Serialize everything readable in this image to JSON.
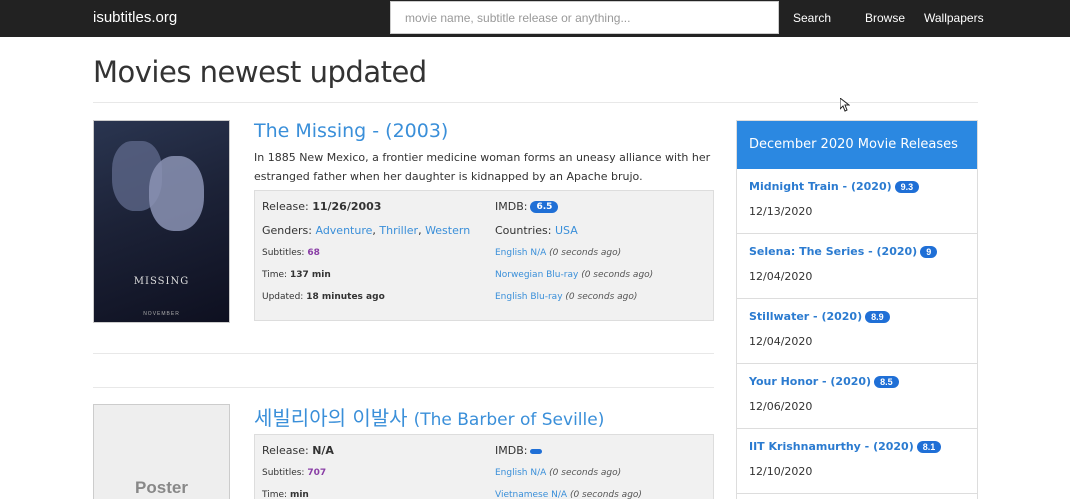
{
  "navbar": {
    "brand": "isubtitles.org",
    "search_placeholder": "movie name, subtitle release or anything...",
    "search_label": "Search",
    "browse_label": "Browse",
    "wallpapers_label": "Wallpapers"
  },
  "page": {
    "title": "Movies newest updated"
  },
  "movies": [
    {
      "title": "The Missing - (2003)",
      "poster_title": "MISSING",
      "poster_date": "NOVEMBER",
      "description": "In 1885 New Mexico, a frontier medicine woman forms an uneasy alliance with her estranged father when her daughter is kidnapped by an Apache brujo.",
      "release_label": "Release:",
      "release": "11/26/2003",
      "imdb_label": "IMDB:",
      "imdb": "6.5",
      "genders_label": "Genders:",
      "genres": [
        "Adventure",
        "Thriller",
        "Western"
      ],
      "countries_label": "Countries:",
      "country": "USA",
      "subtitles_label": "Subtitles:",
      "subtitles": "68",
      "time_label": "Time:",
      "time": "137 min",
      "updated_label": "Updated:",
      "updated": "18 minutes ago",
      "subs": [
        {
          "name": "English N/A",
          "ago": "(0 seconds ago)"
        },
        {
          "name": "Norwegian Blu-ray",
          "ago": "(0 seconds ago)"
        },
        {
          "name": "English Blu-ray",
          "ago": "(0 seconds ago)"
        }
      ]
    },
    {
      "title_native": "세빌리아의 이발사",
      "title_en": "(The Barber of Seville)",
      "poster_text": "Poster",
      "release_label": "Release:",
      "release": "N/A",
      "imdb_label": "IMDB:",
      "subtitles_label": "Subtitles:",
      "subtitles": "707",
      "time_label": "Time:",
      "time": "min",
      "subs": [
        {
          "name": "English N/A",
          "ago": "(0 seconds ago)"
        },
        {
          "name": "Vietnamese N/A",
          "ago": "(0 seconds ago)"
        }
      ]
    }
  ],
  "sidebar": {
    "heading": "December 2020 Movie Releases",
    "items": [
      {
        "title": "Midnight Train  - (2020)",
        "rating": "9.3",
        "date": "12/13/2020"
      },
      {
        "title": "Selena: The Series  - (2020)",
        "rating": "9",
        "date": "12/04/2020"
      },
      {
        "title": "Stillwater  - (2020)",
        "rating": "8.9",
        "date": "12/04/2020"
      },
      {
        "title": "Your Honor  - (2020)",
        "rating": "8.5",
        "date": "12/06/2020"
      },
      {
        "title": "IIT Krishnamurthy  - (2020)",
        "rating": "8.1",
        "date": "12/10/2020"
      }
    ]
  }
}
